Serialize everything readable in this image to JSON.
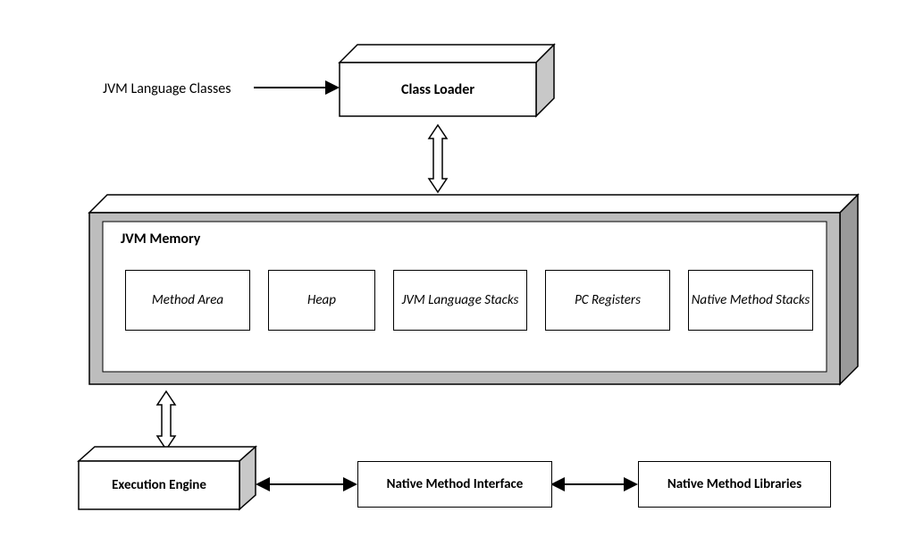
{
  "input_label": "JVM Language Classes",
  "blocks": {
    "class_loader": "Class Loader",
    "jvm_memory_title": "JVM Memory",
    "memory_cells": {
      "method_area": "Method Area",
      "heap": "Heap",
      "lang_stacks": "JVM Language Stacks",
      "pc_registers": "PC Registers",
      "native_stacks": "Native Method Stacks"
    },
    "execution_engine": "Execution Engine",
    "native_iface": "Native Method Interface",
    "native_libs": "Native Method Libraries"
  }
}
